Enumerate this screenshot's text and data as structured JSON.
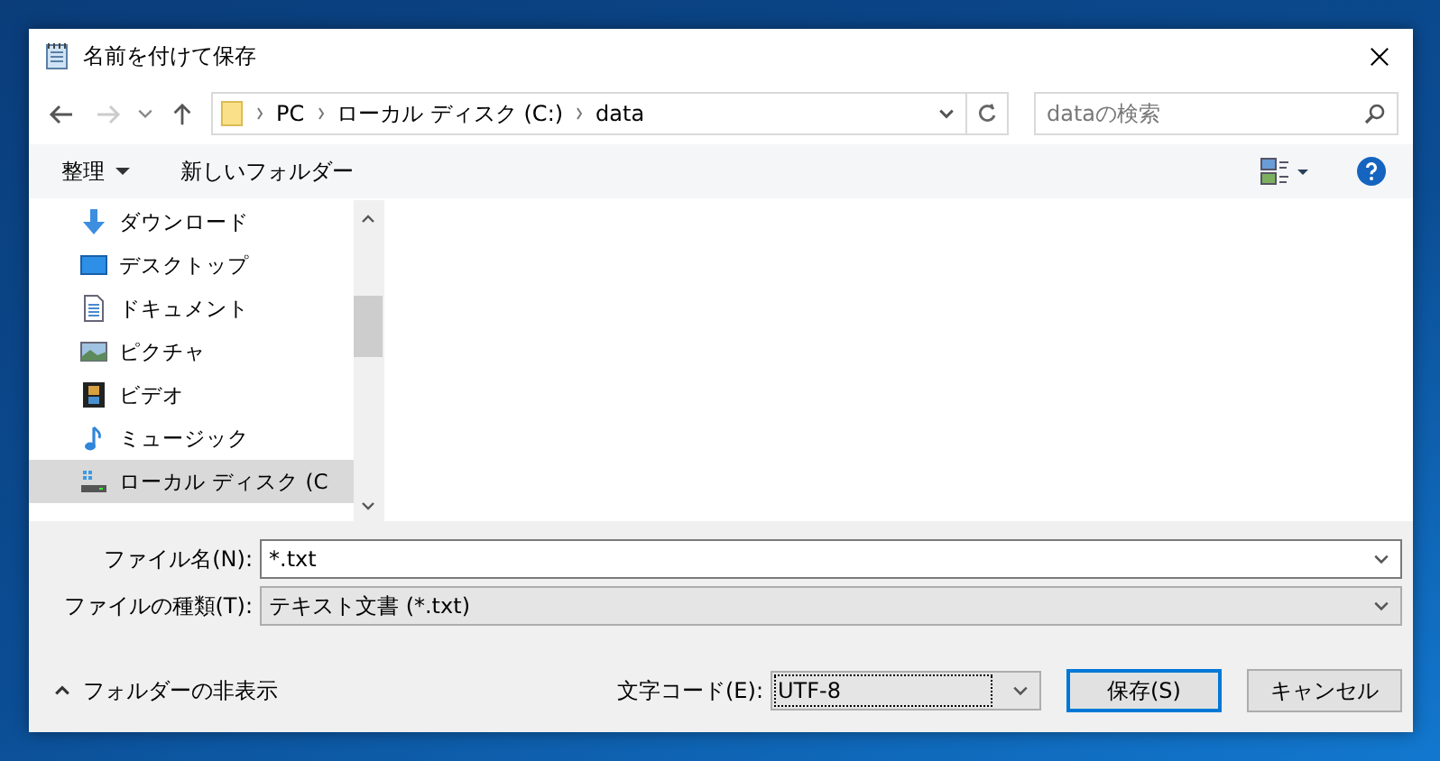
{
  "window": {
    "title": "名前を付けて保存"
  },
  "address_bar": {
    "path": [
      {
        "label": "PC"
      },
      {
        "label": "ローカル ディスク (C:)"
      },
      {
        "label": "data"
      }
    ]
  },
  "search": {
    "placeholder": "dataの検索"
  },
  "toolbar": {
    "organize": "整理",
    "new_folder": "新しいフォルダー"
  },
  "nav_items": [
    {
      "label": "ダウンロード",
      "kind": "download",
      "selected": false
    },
    {
      "label": "デスクトップ",
      "kind": "desktop",
      "selected": false
    },
    {
      "label": "ドキュメント",
      "kind": "document",
      "selected": false
    },
    {
      "label": "ピクチャ",
      "kind": "picture",
      "selected": false
    },
    {
      "label": "ビデオ",
      "kind": "video",
      "selected": false
    },
    {
      "label": "ミュージック",
      "kind": "music",
      "selected": false
    },
    {
      "label": "ローカル ディスク (C",
      "kind": "drive",
      "selected": true
    }
  ],
  "fields": [
    {
      "label": "ファイル名(N):",
      "value": "*.txt",
      "kind": "edit"
    },
    {
      "label": "ファイルの種類(T):",
      "value": "テキスト文書 (*.txt)",
      "kind": "list"
    }
  ],
  "hide_folders": "フォルダーの非表示",
  "encoding": {
    "label": "文字コード(E):",
    "value": "UTF-8"
  },
  "buttons": [
    {
      "label": "保存(S)",
      "default": true
    },
    {
      "label": "キャンセル",
      "default": false
    }
  ]
}
